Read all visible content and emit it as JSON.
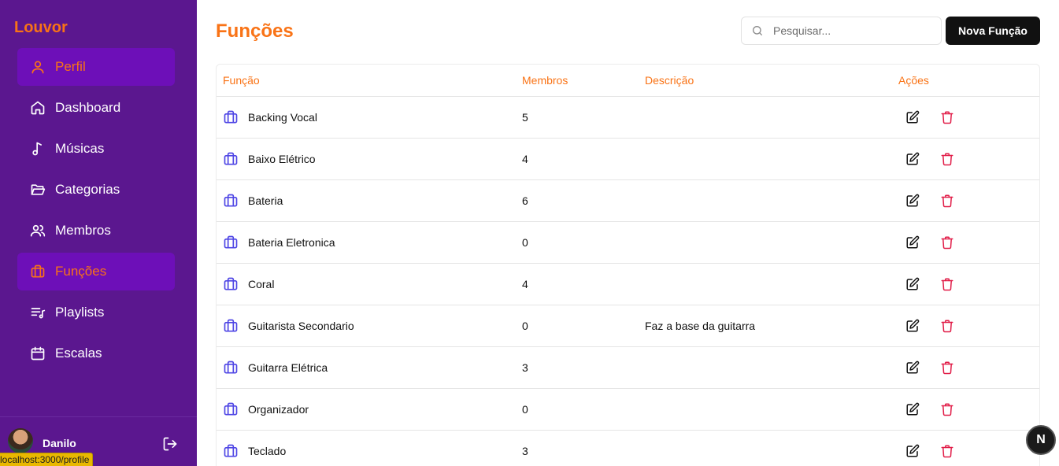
{
  "sidebar": {
    "brand": "Louvor",
    "items": [
      {
        "label": "Perfil",
        "icon": "user-icon",
        "active": true
      },
      {
        "label": "Dashboard",
        "icon": "home-icon",
        "active": false
      },
      {
        "label": "Músicas",
        "icon": "music-note-icon",
        "active": false
      },
      {
        "label": "Categorias",
        "icon": "folder-open-icon",
        "active": false
      },
      {
        "label": "Membros",
        "icon": "users-icon",
        "active": false
      },
      {
        "label": "Funções",
        "icon": "briefcase-icon",
        "active": true
      },
      {
        "label": "Playlists",
        "icon": "list-music-icon",
        "active": false
      },
      {
        "label": "Escalas",
        "icon": "calendar-icon",
        "active": false
      }
    ],
    "user": {
      "name": "Danilo"
    },
    "status_url": "localhost:3000/profile"
  },
  "header": {
    "title": "Funções",
    "search_placeholder": "Pesquisar...",
    "new_button": "Nova Função"
  },
  "table": {
    "columns": {
      "name": "Função",
      "members": "Membros",
      "description": "Descrição",
      "actions": "Ações"
    },
    "rows": [
      {
        "name": "Backing Vocal",
        "members": "5",
        "description": ""
      },
      {
        "name": "Baixo Elétrico",
        "members": "4",
        "description": ""
      },
      {
        "name": "Bateria",
        "members": "6",
        "description": ""
      },
      {
        "name": "Bateria Eletronica",
        "members": "0",
        "description": ""
      },
      {
        "name": "Coral",
        "members": "4",
        "description": ""
      },
      {
        "name": "Guitarista Secondario",
        "members": "0",
        "description": "Faz a base da guitarra"
      },
      {
        "name": "Guitarra Elétrica",
        "members": "3",
        "description": ""
      },
      {
        "name": "Organizador",
        "members": "0",
        "description": ""
      },
      {
        "name": "Teclado",
        "members": "3",
        "description": ""
      }
    ]
  },
  "dev_badge": "N",
  "colors": {
    "sidebar": "#5b178f",
    "active": "#6d0fb8",
    "accent": "#f97316",
    "icon_blue": "#4f46e5",
    "delete_red": "#e11d48"
  }
}
